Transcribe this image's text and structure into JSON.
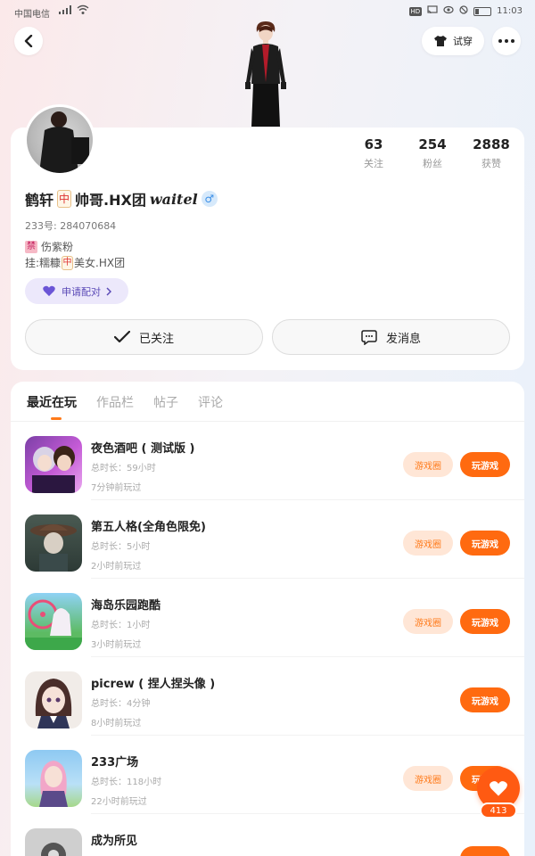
{
  "status_bar": {
    "carrier": "中国电信",
    "time": "11:03",
    "hd": "HD"
  },
  "header": {
    "try_on_label": "试穿"
  },
  "profile": {
    "stats": [
      {
        "value": "63",
        "label": "关注"
      },
      {
        "value": "254",
        "label": "粉丝"
      },
      {
        "value": "2888",
        "label": "获赞"
      }
    ],
    "name_prefix": "鹤轩",
    "name_tile": "中",
    "name_mid": "帅哥.HX团",
    "name_suffix": "waitel",
    "gender": "♂",
    "uid": "233号: 284070684",
    "tag1_icon": "禁",
    "tag1_text": "伤紫粉",
    "tag2_prefix": "挂:糯糠",
    "tag2_tile": "中",
    "tag2_suffix": "美女.HX团",
    "pair_label": "申请配对",
    "followed_label": "已关注",
    "message_label": "发消息"
  },
  "tabs": [
    "最近在玩",
    "作品栏",
    "帖子",
    "评论"
  ],
  "games": [
    {
      "title": "夜色酒吧 ( 测试版 )",
      "duration": "总时长：59小时",
      "last_played": "7分钟前玩过",
      "circle_label": "游戏圈",
      "play_label": "玩游戏",
      "has_circle": true
    },
    {
      "title": "第五人格(全角色限免)",
      "duration": "总时长：5小时",
      "last_played": "2小时前玩过",
      "circle_label": "游戏圈",
      "play_label": "玩游戏",
      "has_circle": true
    },
    {
      "title": "海岛乐园跑酷",
      "duration": "总时长：1小时",
      "last_played": "3小时前玩过",
      "circle_label": "游戏圈",
      "play_label": "玩游戏",
      "has_circle": true
    },
    {
      "title": "picrew ( 捏人捏头像 )",
      "duration": "总时长：4分钟",
      "last_played": "8小时前玩过",
      "circle_label": "",
      "play_label": "玩游戏",
      "has_circle": false
    },
    {
      "title": "233广场",
      "duration": "总时长：118小时",
      "last_played": "22小时前玩过",
      "circle_label": "游戏圈",
      "play_label": "玩游戏",
      "has_circle": true
    },
    {
      "title": "成为所见",
      "duration": "",
      "last_played": "",
      "circle_label": "",
      "play_label": "",
      "has_circle": false
    }
  ],
  "like_fab": {
    "count": "413"
  }
}
